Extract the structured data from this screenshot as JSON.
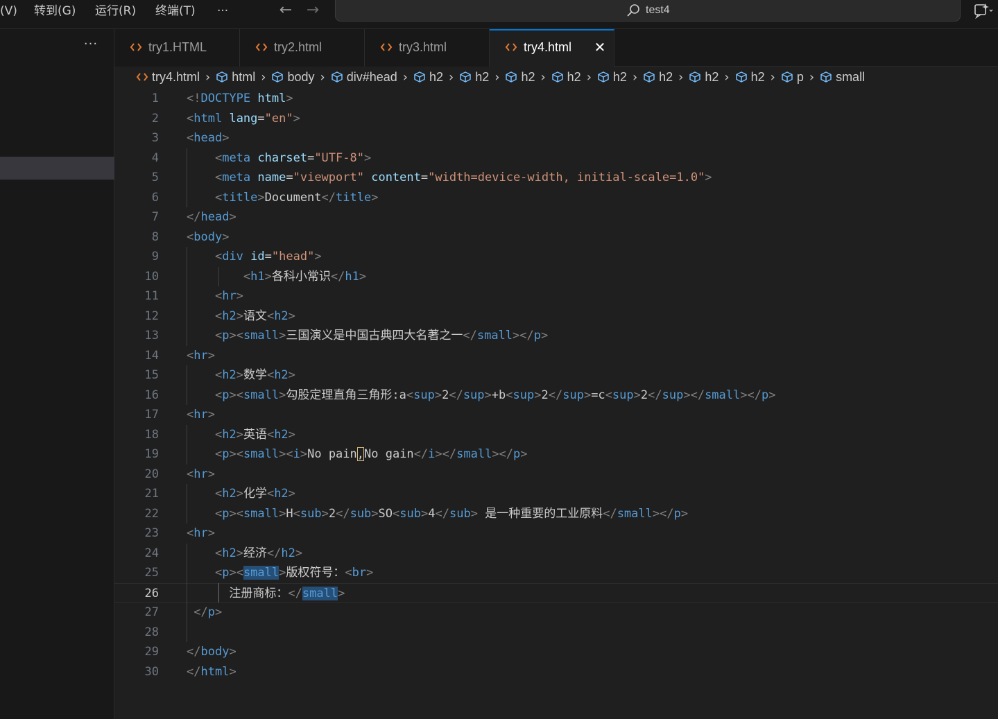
{
  "menu": {
    "view": "(V)",
    "goto": "转到(G)",
    "run": "运行(R)",
    "terminal": "终端(T)",
    "more": "···"
  },
  "nav": {
    "back": "←",
    "forward": "→"
  },
  "search": {
    "text": "test4",
    "icon": "search-icon"
  },
  "sidebar": {
    "more": "···"
  },
  "tabs": [
    {
      "label": "try1.HTML",
      "active": false
    },
    {
      "label": "try2.html",
      "active": false
    },
    {
      "label": "try3.html",
      "active": false
    },
    {
      "label": "try4.html",
      "active": true,
      "close": "✕"
    }
  ],
  "breadcrumb": {
    "file": "try4.html",
    "parts": [
      "html",
      "body",
      "div#head",
      "h2",
      "h2",
      "h2",
      "h2",
      "h2",
      "h2",
      "h2",
      "h2",
      "p",
      "small"
    ]
  },
  "editor": {
    "current_line": 26,
    "lines": [
      [
        [
          "t-br",
          "<!"
        ],
        [
          "t-tag",
          "DOCTYPE"
        ],
        [
          "t-txt",
          " "
        ],
        [
          "t-attr",
          "html"
        ],
        [
          "t-br",
          ">"
        ]
      ],
      [
        [
          "t-br",
          "<"
        ],
        [
          "t-tag",
          "html"
        ],
        [
          "t-txt",
          " "
        ],
        [
          "t-attr",
          "lang"
        ],
        [
          "t-txt",
          "="
        ],
        [
          "t-str",
          "\"en\""
        ],
        [
          "t-br",
          ">"
        ]
      ],
      [
        [
          "t-br",
          "<"
        ],
        [
          "t-tag",
          "head"
        ],
        [
          "t-br",
          ">"
        ]
      ],
      [
        [
          "t-txt",
          "    "
        ],
        [
          "t-br",
          "<"
        ],
        [
          "t-tag",
          "meta"
        ],
        [
          "t-txt",
          " "
        ],
        [
          "t-attr",
          "charset"
        ],
        [
          "t-txt",
          "="
        ],
        [
          "t-str",
          "\"UTF-8\""
        ],
        [
          "t-br",
          ">"
        ]
      ],
      [
        [
          "t-txt",
          "    "
        ],
        [
          "t-br",
          "<"
        ],
        [
          "t-tag",
          "meta"
        ],
        [
          "t-txt",
          " "
        ],
        [
          "t-attr",
          "name"
        ],
        [
          "t-txt",
          "="
        ],
        [
          "t-str",
          "\"viewport\""
        ],
        [
          "t-txt",
          " "
        ],
        [
          "t-attr",
          "content"
        ],
        [
          "t-txt",
          "="
        ],
        [
          "t-str",
          "\"width=device-width, initial-scale=1.0\""
        ],
        [
          "t-br",
          ">"
        ]
      ],
      [
        [
          "t-txt",
          "    "
        ],
        [
          "t-br",
          "<"
        ],
        [
          "t-tag",
          "title"
        ],
        [
          "t-br",
          ">"
        ],
        [
          "t-txt",
          "Document"
        ],
        [
          "t-br",
          "</"
        ],
        [
          "t-tag",
          "title"
        ],
        [
          "t-br",
          ">"
        ]
      ],
      [
        [
          "t-br",
          "</"
        ],
        [
          "t-tag",
          "head"
        ],
        [
          "t-br",
          ">"
        ]
      ],
      [
        [
          "t-br",
          "<"
        ],
        [
          "t-tag",
          "body"
        ],
        [
          "t-br",
          ">"
        ]
      ],
      [
        [
          "t-txt",
          "    "
        ],
        [
          "t-br",
          "<"
        ],
        [
          "t-tag",
          "div"
        ],
        [
          "t-txt",
          " "
        ],
        [
          "t-attr",
          "id"
        ],
        [
          "t-txt",
          "="
        ],
        [
          "t-str",
          "\"head\""
        ],
        [
          "t-br",
          ">"
        ]
      ],
      [
        [
          "t-txt",
          "        "
        ],
        [
          "t-br",
          "<"
        ],
        [
          "t-tag",
          "h1"
        ],
        [
          "t-br",
          ">"
        ],
        [
          "t-txt",
          "各科小常识"
        ],
        [
          "t-br",
          "</"
        ],
        [
          "t-tag",
          "h1"
        ],
        [
          "t-br",
          ">"
        ]
      ],
      [
        [
          "t-txt",
          "    "
        ],
        [
          "t-br",
          "<"
        ],
        [
          "t-tag",
          "hr"
        ],
        [
          "t-br",
          ">"
        ]
      ],
      [
        [
          "t-txt",
          "    "
        ],
        [
          "t-br",
          "<"
        ],
        [
          "t-tag",
          "h2"
        ],
        [
          "t-br",
          ">"
        ],
        [
          "t-txt",
          "语文"
        ],
        [
          "t-br",
          "<"
        ],
        [
          "t-tag",
          "h2"
        ],
        [
          "t-br",
          ">"
        ]
      ],
      [
        [
          "t-txt",
          "    "
        ],
        [
          "t-br",
          "<"
        ],
        [
          "t-tag",
          "p"
        ],
        [
          "t-br",
          "><"
        ],
        [
          "t-tag",
          "small"
        ],
        [
          "t-br",
          ">"
        ],
        [
          "t-txt",
          "三国演义是中国古典四大名著之一"
        ],
        [
          "t-br",
          "</"
        ],
        [
          "t-tag",
          "small"
        ],
        [
          "t-br",
          "></"
        ],
        [
          "t-tag",
          "p"
        ],
        [
          "t-br",
          ">"
        ]
      ],
      [
        [
          "t-br",
          "<"
        ],
        [
          "t-tag",
          "hr"
        ],
        [
          "t-br",
          ">"
        ]
      ],
      [
        [
          "t-txt",
          "    "
        ],
        [
          "t-br",
          "<"
        ],
        [
          "t-tag",
          "h2"
        ],
        [
          "t-br",
          ">"
        ],
        [
          "t-txt",
          "数学"
        ],
        [
          "t-br",
          "<"
        ],
        [
          "t-tag",
          "h2"
        ],
        [
          "t-br",
          ">"
        ]
      ],
      [
        [
          "t-txt",
          "    "
        ],
        [
          "t-br",
          "<"
        ],
        [
          "t-tag",
          "p"
        ],
        [
          "t-br",
          "><"
        ],
        [
          "t-tag",
          "small"
        ],
        [
          "t-br",
          ">"
        ],
        [
          "t-txt",
          "勾股定理直角三角形:a"
        ],
        [
          "t-br",
          "<"
        ],
        [
          "t-tag",
          "sup"
        ],
        [
          "t-br",
          ">"
        ],
        [
          "t-txt",
          "2"
        ],
        [
          "t-br",
          "</"
        ],
        [
          "t-tag",
          "sup"
        ],
        [
          "t-br",
          ">"
        ],
        [
          "t-txt",
          "+b"
        ],
        [
          "t-br",
          "<"
        ],
        [
          "t-tag",
          "sup"
        ],
        [
          "t-br",
          ">"
        ],
        [
          "t-txt",
          "2"
        ],
        [
          "t-br",
          "</"
        ],
        [
          "t-tag",
          "sup"
        ],
        [
          "t-br",
          ">"
        ],
        [
          "t-txt",
          "=c"
        ],
        [
          "t-br",
          "<"
        ],
        [
          "t-tag",
          "sup"
        ],
        [
          "t-br",
          ">"
        ],
        [
          "t-txt",
          "2"
        ],
        [
          "t-br",
          "</"
        ],
        [
          "t-tag",
          "sup"
        ],
        [
          "t-br",
          "></"
        ],
        [
          "t-tag",
          "small"
        ],
        [
          "t-br",
          "></"
        ],
        [
          "t-tag",
          "p"
        ],
        [
          "t-br",
          ">"
        ]
      ],
      [
        [
          "t-br",
          "<"
        ],
        [
          "t-tag",
          "hr"
        ],
        [
          "t-br",
          ">"
        ]
      ],
      [
        [
          "t-txt",
          "    "
        ],
        [
          "t-br",
          "<"
        ],
        [
          "t-tag",
          "h2"
        ],
        [
          "t-br",
          ">"
        ],
        [
          "t-txt",
          "英语"
        ],
        [
          "t-br",
          "<"
        ],
        [
          "t-tag",
          "h2"
        ],
        [
          "t-br",
          ">"
        ]
      ],
      [
        [
          "t-txt",
          "    "
        ],
        [
          "t-br",
          "<"
        ],
        [
          "t-tag",
          "p"
        ],
        [
          "t-br",
          "><"
        ],
        [
          "t-tag",
          "small"
        ],
        [
          "t-br",
          "><"
        ],
        [
          "t-tag",
          "i"
        ],
        [
          "t-br",
          ">"
        ],
        [
          "t-txt",
          "No pain"
        ],
        [
          "t-txt t-box",
          ","
        ],
        [
          "t-txt",
          "No gain"
        ],
        [
          "t-br",
          "</"
        ],
        [
          "t-tag",
          "i"
        ],
        [
          "t-br",
          "></"
        ],
        [
          "t-tag",
          "small"
        ],
        [
          "t-br",
          "></"
        ],
        [
          "t-tag",
          "p"
        ],
        [
          "t-br",
          ">"
        ]
      ],
      [
        [
          "t-br",
          "<"
        ],
        [
          "t-tag",
          "hr"
        ],
        [
          "t-br",
          ">"
        ]
      ],
      [
        [
          "t-txt",
          "    "
        ],
        [
          "t-br",
          "<"
        ],
        [
          "t-tag",
          "h2"
        ],
        [
          "t-br",
          ">"
        ],
        [
          "t-txt",
          "化学"
        ],
        [
          "t-br",
          "<"
        ],
        [
          "t-tag",
          "h2"
        ],
        [
          "t-br",
          ">"
        ]
      ],
      [
        [
          "t-txt",
          "    "
        ],
        [
          "t-br",
          "<"
        ],
        [
          "t-tag",
          "p"
        ],
        [
          "t-br",
          "><"
        ],
        [
          "t-tag",
          "small"
        ],
        [
          "t-br",
          ">"
        ],
        [
          "t-txt",
          "H"
        ],
        [
          "t-br",
          "<"
        ],
        [
          "t-tag",
          "sub"
        ],
        [
          "t-br",
          ">"
        ],
        [
          "t-txt",
          "2"
        ],
        [
          "t-br",
          "</"
        ],
        [
          "t-tag",
          "sub"
        ],
        [
          "t-br",
          ">"
        ],
        [
          "t-txt",
          "SO"
        ],
        [
          "t-br",
          "<"
        ],
        [
          "t-tag",
          "sub"
        ],
        [
          "t-br",
          ">"
        ],
        [
          "t-txt",
          "4"
        ],
        [
          "t-br",
          "</"
        ],
        [
          "t-tag",
          "sub"
        ],
        [
          "t-br",
          ">"
        ],
        [
          "t-txt",
          " 是一种重要的工业原料"
        ],
        [
          "t-br",
          "</"
        ],
        [
          "t-tag",
          "small"
        ],
        [
          "t-br",
          "></"
        ],
        [
          "t-tag",
          "p"
        ],
        [
          "t-br",
          ">"
        ]
      ],
      [
        [
          "t-br",
          "<"
        ],
        [
          "t-tag",
          "hr"
        ],
        [
          "t-br",
          ">"
        ]
      ],
      [
        [
          "t-txt",
          "    "
        ],
        [
          "t-br",
          "<"
        ],
        [
          "t-tag",
          "h2"
        ],
        [
          "t-br",
          ">"
        ],
        [
          "t-txt",
          "经济"
        ],
        [
          "t-br",
          "</"
        ],
        [
          "t-tag",
          "h2"
        ],
        [
          "t-br",
          ">"
        ]
      ],
      [
        [
          "t-txt",
          "    "
        ],
        [
          "t-br",
          "<"
        ],
        [
          "t-tag",
          "p"
        ],
        [
          "t-br",
          "><"
        ],
        [
          "t-tag t-hl",
          "small"
        ],
        [
          "t-br",
          ">"
        ],
        [
          "t-txt",
          "版权符号："
        ],
        [
          "t-br",
          "<"
        ],
        [
          "t-tag",
          "br"
        ],
        [
          "t-br",
          ">"
        ]
      ],
      [
        [
          "t-txt",
          "      注册商标："
        ],
        [
          "t-br",
          "</"
        ],
        [
          "t-tag t-hl",
          "small"
        ],
        [
          "t-br",
          ">"
        ]
      ],
      [
        [
          "t-txt",
          " "
        ],
        [
          "t-br",
          "</"
        ],
        [
          "t-tag",
          "p"
        ],
        [
          "t-br",
          ">"
        ]
      ],
      [
        [
          "t-txt",
          ""
        ]
      ],
      [
        [
          "t-br",
          "</"
        ],
        [
          "t-tag",
          "body"
        ],
        [
          "t-br",
          ">"
        ]
      ],
      [
        [
          "t-br",
          "</"
        ],
        [
          "t-tag",
          "html"
        ],
        [
          "t-br",
          ">"
        ]
      ]
    ]
  }
}
